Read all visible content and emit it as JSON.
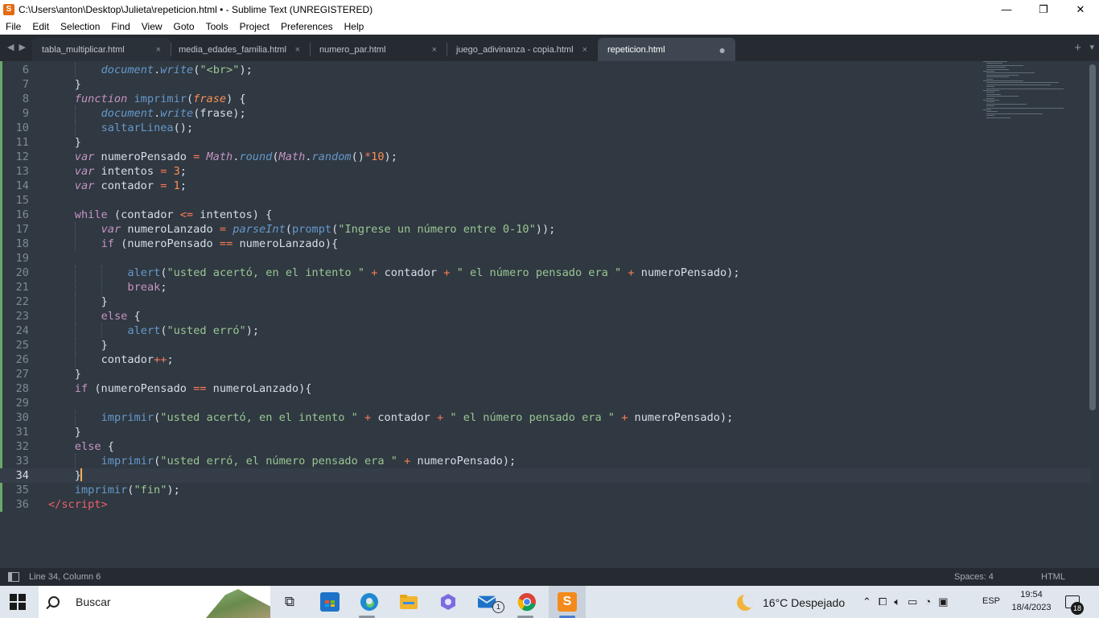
{
  "window": {
    "title": "C:\\Users\\anton\\Desktop\\Julieta\\repeticion.html • - Sublime Text (UNREGISTERED)",
    "minimize_glyph": "—",
    "maximize_glyph": "❐",
    "close_glyph": "✕"
  },
  "menu": [
    "File",
    "Edit",
    "Selection",
    "Find",
    "View",
    "Goto",
    "Tools",
    "Project",
    "Preferences",
    "Help"
  ],
  "tabs": [
    {
      "label": "tabla_multiplicar.html",
      "close": "×",
      "active": false
    },
    {
      "label": "media_edades_familia.html",
      "close": "×",
      "active": false
    },
    {
      "label": "numero_par.html",
      "close": "×",
      "active": false
    },
    {
      "label": "juego_adivinanza - copia.html",
      "close": "×",
      "active": false
    },
    {
      "label": "repeticion.html",
      "close": "●",
      "active": true
    }
  ],
  "tabbar": {
    "nav_left": "◀",
    "nav_right": "▶",
    "add": "+",
    "more": "▾"
  },
  "editor": {
    "current_line": 34,
    "lines": [
      {
        "n": "6",
        "indent": 2,
        "tokens": [
          [
            "c-fni",
            "document"
          ],
          [
            "c-pl",
            "."
          ],
          [
            "c-fni",
            "write"
          ],
          [
            "c-pl",
            "("
          ],
          [
            "c-str",
            "\"<br>\""
          ],
          [
            "c-pl",
            ");"
          ]
        ]
      },
      {
        "n": "7",
        "indent": 1,
        "tokens": [
          [
            "c-pl",
            "}"
          ]
        ]
      },
      {
        "n": "8",
        "indent": 1,
        "tokens": [
          [
            "c-it",
            "function"
          ],
          [
            "c-pl",
            " "
          ],
          [
            "c-fn",
            "imprimir"
          ],
          [
            "c-pl",
            "("
          ],
          [
            "c-par",
            "frase"
          ],
          [
            "c-pl",
            ") {"
          ]
        ]
      },
      {
        "n": "9",
        "indent": 2,
        "tokens": [
          [
            "c-fni",
            "document"
          ],
          [
            "c-pl",
            "."
          ],
          [
            "c-fni",
            "write"
          ],
          [
            "c-pl",
            "(frase);"
          ]
        ]
      },
      {
        "n": "10",
        "indent": 2,
        "tokens": [
          [
            "c-fn",
            "saltarLinea"
          ],
          [
            "c-pl",
            "();"
          ]
        ]
      },
      {
        "n": "11",
        "indent": 1,
        "tokens": [
          [
            "c-pl",
            "}"
          ]
        ]
      },
      {
        "n": "12",
        "indent": 1,
        "tokens": [
          [
            "c-it",
            "var"
          ],
          [
            "c-pl",
            " numeroPensado "
          ],
          [
            "c-op",
            "="
          ],
          [
            "c-pl",
            " "
          ],
          [
            "c-it",
            "Math"
          ],
          [
            "c-pl",
            "."
          ],
          [
            "c-fni",
            "round"
          ],
          [
            "c-pl",
            "("
          ],
          [
            "c-it",
            "Math"
          ],
          [
            "c-pl",
            "."
          ],
          [
            "c-fni",
            "random"
          ],
          [
            "c-pl",
            "()"
          ],
          [
            "c-op",
            "*"
          ],
          [
            "c-num",
            "10"
          ],
          [
            "c-pl",
            ");"
          ]
        ]
      },
      {
        "n": "13",
        "indent": 1,
        "tokens": [
          [
            "c-it",
            "var"
          ],
          [
            "c-pl",
            " intentos "
          ],
          [
            "c-op",
            "="
          ],
          [
            "c-pl",
            " "
          ],
          [
            "c-num",
            "3"
          ],
          [
            "c-pl",
            ";"
          ]
        ]
      },
      {
        "n": "14",
        "indent": 1,
        "tokens": [
          [
            "c-it",
            "var"
          ],
          [
            "c-pl",
            " contador "
          ],
          [
            "c-op",
            "="
          ],
          [
            "c-pl",
            " "
          ],
          [
            "c-num",
            "1"
          ],
          [
            "c-pl",
            ";"
          ]
        ]
      },
      {
        "n": "15",
        "indent": 0,
        "tokens": []
      },
      {
        "n": "16",
        "indent": 1,
        "tokens": [
          [
            "c-kw",
            "while"
          ],
          [
            "c-pl",
            " (contador "
          ],
          [
            "c-op",
            "<="
          ],
          [
            "c-pl",
            " intentos) {"
          ]
        ]
      },
      {
        "n": "17",
        "indent": 2,
        "tokens": [
          [
            "c-it",
            "var"
          ],
          [
            "c-pl",
            " numeroLanzado "
          ],
          [
            "c-op",
            "="
          ],
          [
            "c-pl",
            " "
          ],
          [
            "c-fni",
            "parseInt"
          ],
          [
            "c-pl",
            "("
          ],
          [
            "c-fn",
            "prompt"
          ],
          [
            "c-pl",
            "("
          ],
          [
            "c-str",
            "\"Ingrese un número entre 0-10\""
          ],
          [
            "c-pl",
            "));"
          ]
        ]
      },
      {
        "n": "18",
        "indent": 2,
        "tokens": [
          [
            "c-kw",
            "if"
          ],
          [
            "c-pl",
            " (numeroPensado "
          ],
          [
            "c-op",
            "=="
          ],
          [
            "c-pl",
            " numeroLanzado){"
          ]
        ]
      },
      {
        "n": "19",
        "indent": 0,
        "tokens": []
      },
      {
        "n": "20",
        "indent": 3,
        "tokens": [
          [
            "c-fn",
            "alert"
          ],
          [
            "c-pl",
            "("
          ],
          [
            "c-str",
            "\"usted acertó, en el intento \""
          ],
          [
            "c-pl",
            " "
          ],
          [
            "c-op",
            "+"
          ],
          [
            "c-pl",
            " contador "
          ],
          [
            "c-op",
            "+"
          ],
          [
            "c-pl",
            " "
          ],
          [
            "c-str",
            "\" el número pensado era \""
          ],
          [
            "c-pl",
            " "
          ],
          [
            "c-op",
            "+"
          ],
          [
            "c-pl",
            " numeroPensado);"
          ]
        ]
      },
      {
        "n": "21",
        "indent": 3,
        "tokens": [
          [
            "c-kw",
            "break"
          ],
          [
            "c-pl",
            ";"
          ]
        ]
      },
      {
        "n": "22",
        "indent": 2,
        "tokens": [
          [
            "c-pl",
            "}"
          ]
        ]
      },
      {
        "n": "23",
        "indent": 2,
        "tokens": [
          [
            "c-kw",
            "else"
          ],
          [
            "c-pl",
            " {"
          ]
        ]
      },
      {
        "n": "24",
        "indent": 3,
        "tokens": [
          [
            "c-fn",
            "alert"
          ],
          [
            "c-pl",
            "("
          ],
          [
            "c-str",
            "\"usted erró\""
          ],
          [
            "c-pl",
            ");"
          ]
        ]
      },
      {
        "n": "25",
        "indent": 2,
        "tokens": [
          [
            "c-pl",
            "}"
          ]
        ]
      },
      {
        "n": "26",
        "indent": 2,
        "tokens": [
          [
            "c-pl",
            "contador"
          ],
          [
            "c-op",
            "++"
          ],
          [
            "c-pl",
            ";"
          ]
        ]
      },
      {
        "n": "27",
        "indent": 1,
        "tokens": [
          [
            "c-pl",
            "}"
          ]
        ]
      },
      {
        "n": "28",
        "indent": 1,
        "tokens": [
          [
            "c-kw",
            "if"
          ],
          [
            "c-pl",
            " (numeroPensado "
          ],
          [
            "c-op",
            "=="
          ],
          [
            "c-pl",
            " numeroLanzado){"
          ]
        ]
      },
      {
        "n": "29",
        "indent": 0,
        "tokens": []
      },
      {
        "n": "30",
        "indent": 2,
        "tokens": [
          [
            "c-fn",
            "imprimir"
          ],
          [
            "c-pl",
            "("
          ],
          [
            "c-str",
            "\"usted acertó, en el intento \""
          ],
          [
            "c-pl",
            " "
          ],
          [
            "c-op",
            "+"
          ],
          [
            "c-pl",
            " contador "
          ],
          [
            "c-op",
            "+"
          ],
          [
            "c-pl",
            " "
          ],
          [
            "c-str",
            "\" el número pensado era \""
          ],
          [
            "c-pl",
            " "
          ],
          [
            "c-op",
            "+"
          ],
          [
            "c-pl",
            " numeroPensado);"
          ]
        ]
      },
      {
        "n": "31",
        "indent": 1,
        "tokens": [
          [
            "c-pl",
            "}"
          ]
        ]
      },
      {
        "n": "32",
        "indent": 1,
        "tokens": [
          [
            "c-kw",
            "else"
          ],
          [
            "c-pl",
            " {"
          ]
        ]
      },
      {
        "n": "33",
        "indent": 2,
        "tokens": [
          [
            "c-fn",
            "imprimir"
          ],
          [
            "c-pl",
            "("
          ],
          [
            "c-str",
            "\"usted erró, el número pensado era \""
          ],
          [
            "c-pl",
            " "
          ],
          [
            "c-op",
            "+"
          ],
          [
            "c-pl",
            " numeroPensado);"
          ]
        ]
      },
      {
        "n": "34",
        "indent": 1,
        "tokens": [
          [
            "c-pl",
            "}"
          ],
          [
            "cursor",
            ""
          ]
        ]
      },
      {
        "n": "35",
        "indent": 1,
        "tokens": [
          [
            "c-fn",
            "imprimir"
          ],
          [
            "c-pl",
            "("
          ],
          [
            "c-str",
            "\"fin\""
          ],
          [
            "c-pl",
            ");"
          ]
        ]
      },
      {
        "n": "36",
        "indent": 0,
        "tokens": [
          [
            "c-tag",
            "</"
          ],
          [
            "c-tag",
            "script"
          ],
          [
            "c-tag",
            ">"
          ]
        ]
      }
    ]
  },
  "statusbar": {
    "position": "Line 34, Column 6",
    "spaces": "Spaces: 4",
    "syntax": "HTML"
  },
  "taskbar": {
    "search_placeholder": "Buscar",
    "weather": "16°C  Despejado",
    "language": "ESP",
    "time": "19:54",
    "date": "18/4/2023",
    "notifications": "18",
    "mail_badge": "1",
    "colors": {
      "edge": "#1f8ad2",
      "store": "#1e73c8",
      "files": "#f2b62c",
      "chrome_red": "#db4437",
      "sublime": "#f38b1c"
    }
  }
}
